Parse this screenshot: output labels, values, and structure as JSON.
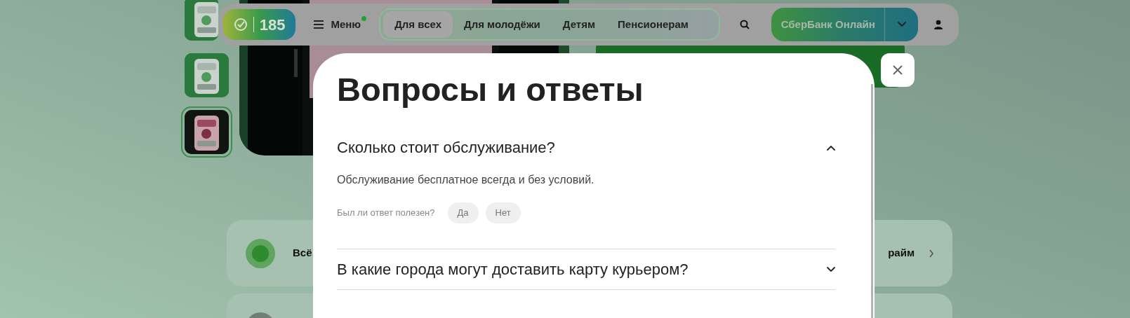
{
  "page": {
    "thumbnails": [
      {
        "selected": false
      },
      {
        "selected": false
      },
      {
        "selected": true
      }
    ],
    "cards": [
      {
        "kind": "link",
        "title": "Всё",
        "trailing": "райм"
      },
      {
        "kind": "link"
      }
    ]
  },
  "header": {
    "logo_text": "185",
    "menu": {
      "label": "Меню",
      "badge": true
    },
    "tabs": [
      {
        "label": "Для всех",
        "selected": true
      },
      {
        "label": "Для молодёжи",
        "selected": false
      },
      {
        "label": "Детям",
        "selected": false
      },
      {
        "label": "Пенсионерам",
        "selected": false
      }
    ],
    "cta": "СберБанк Онлайн"
  },
  "modal": {
    "title": "Вопросы и ответы",
    "items": [
      {
        "question": "Сколько стоит обслуживание?",
        "expanded": true,
        "answer": "Обслуживание бесплатное всегда и без условий.",
        "feedback": {
          "prompt": "Был ли ответ полезен?",
          "options": [
            "Да",
            "Нет"
          ]
        }
      },
      {
        "question": "В какие города могут доставить карту курьером?",
        "expanded": false
      }
    ]
  }
}
